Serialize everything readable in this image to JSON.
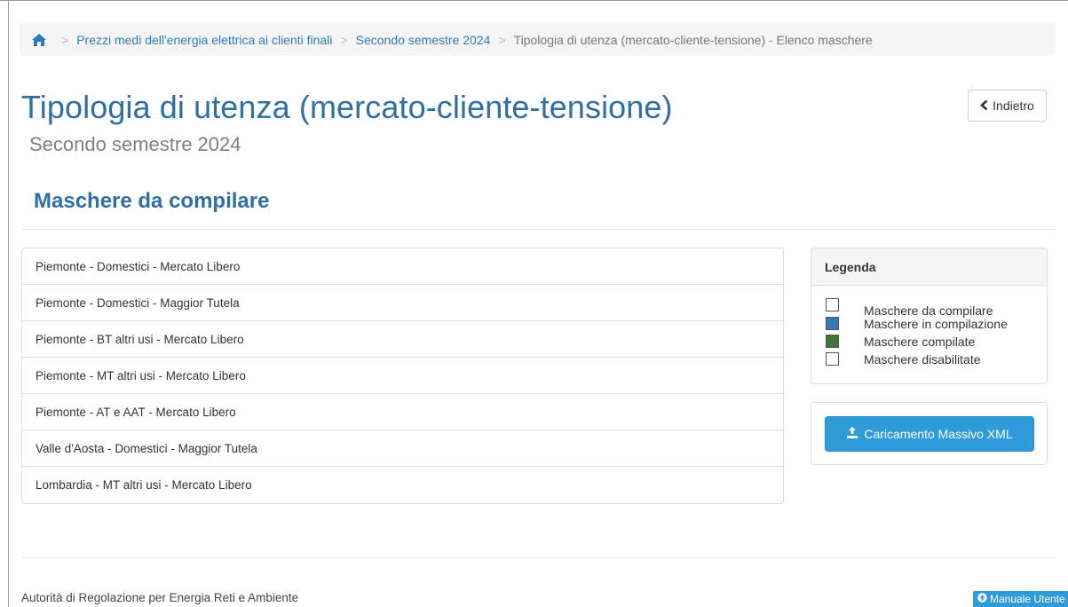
{
  "breadcrumb": {
    "items": [
      "Prezzi medi dell'energia elettrica ai clienti finali",
      "Secondo semestre 2024"
    ],
    "current": "Tipologia di utenza (mercato-cliente-tensione) - Elenco maschere",
    "separator": ">"
  },
  "header": {
    "title": "Tipologia di utenza (mercato-cliente-tensione)",
    "subtitle": "Secondo semestre 2024",
    "back_label": "Indietro"
  },
  "section": {
    "title": "Maschere da compilare"
  },
  "masks": [
    "Piemonte - Domestici - Mercato Libero",
    "Piemonte - Domestici - Maggior Tutela",
    "Piemonte - BT altri usi - Mercato Libero",
    "Piemonte - MT altri usi - Mercato Libero",
    "Piemonte - AT e AAT - Mercato Libero",
    "Valle d'Aosta - Domestici - Maggior Tutela",
    "Lombardia - MT altri usi - Mercato Libero"
  ],
  "legend": {
    "title": "Legenda",
    "items": [
      {
        "label": "Maschere da compilare",
        "color": "#ffffff"
      },
      {
        "label": "Maschere in compilazione",
        "color": "#337ab7"
      },
      {
        "label": "Maschere compilate",
        "color": "#3c763d"
      },
      {
        "label": "Maschere disabilitate",
        "color": "#ffffff"
      }
    ]
  },
  "upload": {
    "label": "Caricamento Massivo XML",
    "icon": "upload-icon"
  },
  "footer": {
    "text": "Autorità di Regolazione per Energia Reti e Ambiente",
    "manual_label": "Manuale Utente",
    "manual_icon": "circle-arrow-up-icon"
  },
  "colors": {
    "link": "#2a7bbf",
    "title": "#2f6fa3",
    "primary_button": "#2f9bd8"
  }
}
